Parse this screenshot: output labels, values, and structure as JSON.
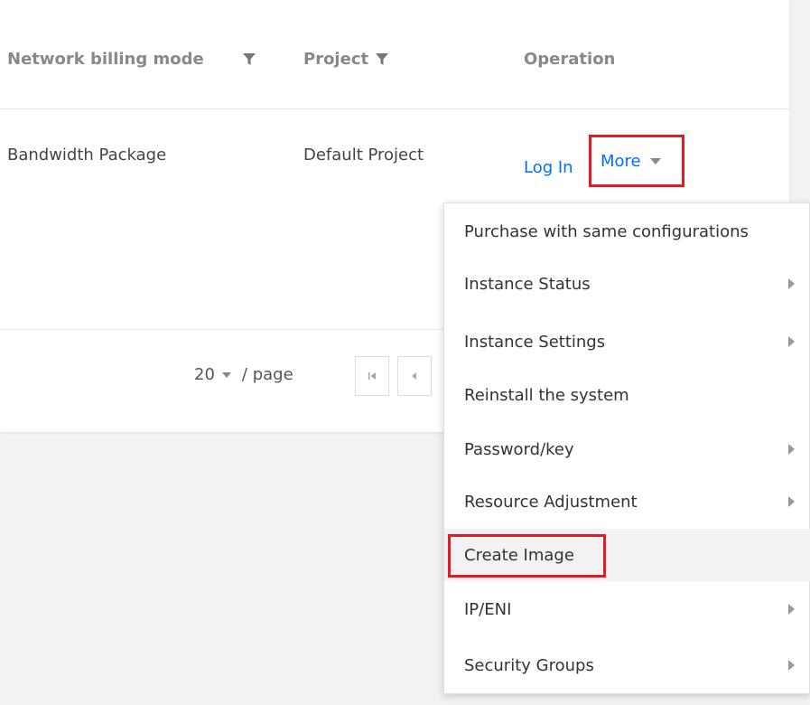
{
  "table": {
    "headers": {
      "network_billing_mode": "Network billing mode",
      "project": "Project",
      "operation": "Operation"
    },
    "row": {
      "network_billing_mode": "Bandwidth Package",
      "project": "Default Project",
      "login": "Log In",
      "more": "More"
    }
  },
  "pagination": {
    "page_size": "20",
    "per_page_label": "/ page"
  },
  "menu": {
    "items": [
      {
        "label": "Purchase with same configurations",
        "has_submenu": false
      },
      {
        "label": "Instance Status",
        "has_submenu": true
      },
      {
        "label": "Instance Settings",
        "has_submenu": true
      },
      {
        "label": "Reinstall the system",
        "has_submenu": false
      },
      {
        "label": "Password/key",
        "has_submenu": true
      },
      {
        "label": "Resource Adjustment",
        "has_submenu": true
      },
      {
        "label": "Create Image",
        "has_submenu": false
      },
      {
        "label": "IP/ENI",
        "has_submenu": true
      },
      {
        "label": "Security Groups",
        "has_submenu": true
      }
    ]
  },
  "colors": {
    "link": "#006eff",
    "highlight": "#e21b24",
    "header_text": "#888888"
  }
}
